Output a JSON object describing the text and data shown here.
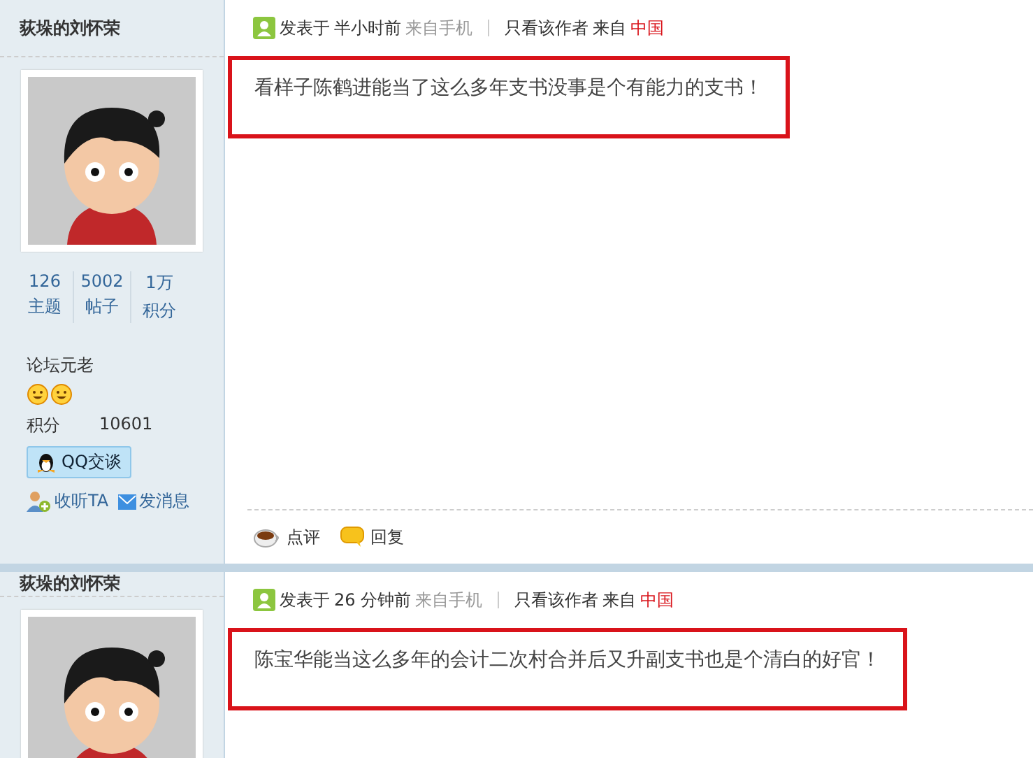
{
  "posts": [
    {
      "author": "荻垛的刘怀荣",
      "stats": [
        {
          "value": "126",
          "label": "主题"
        },
        {
          "value": "5002",
          "label": "帖子"
        },
        {
          "value": "1万",
          "label": "积分"
        }
      ],
      "rank": "论坛元老",
      "points_label": "积分",
      "points_value": "10601",
      "qq_button": "QQ交谈",
      "user_links": [
        {
          "kind": "follow",
          "label": "收听TA"
        },
        {
          "kind": "message",
          "label": "发消息"
        }
      ],
      "meta": {
        "prefix": "发表于",
        "time": "半小时前",
        "source": "来自手机",
        "only_author": "只看该作者",
        "from": "来自",
        "location": "中国"
      },
      "content": "看样子陈鹤进能当了这么多年支书没事是个有能力的支书！",
      "actions": [
        {
          "kind": "comment",
          "label": "点评"
        },
        {
          "kind": "reply",
          "label": "回复"
        }
      ]
    },
    {
      "author": "荻垛的刘怀荣",
      "meta": {
        "prefix": "发表于",
        "time": "26 分钟前",
        "source": "来自手机",
        "only_author": "只看该作者",
        "from": "来自",
        "location": "中国"
      },
      "content": "陈宝华能当这么多年的会计二次村合并后又升副支书也是个清白的好官！"
    }
  ]
}
